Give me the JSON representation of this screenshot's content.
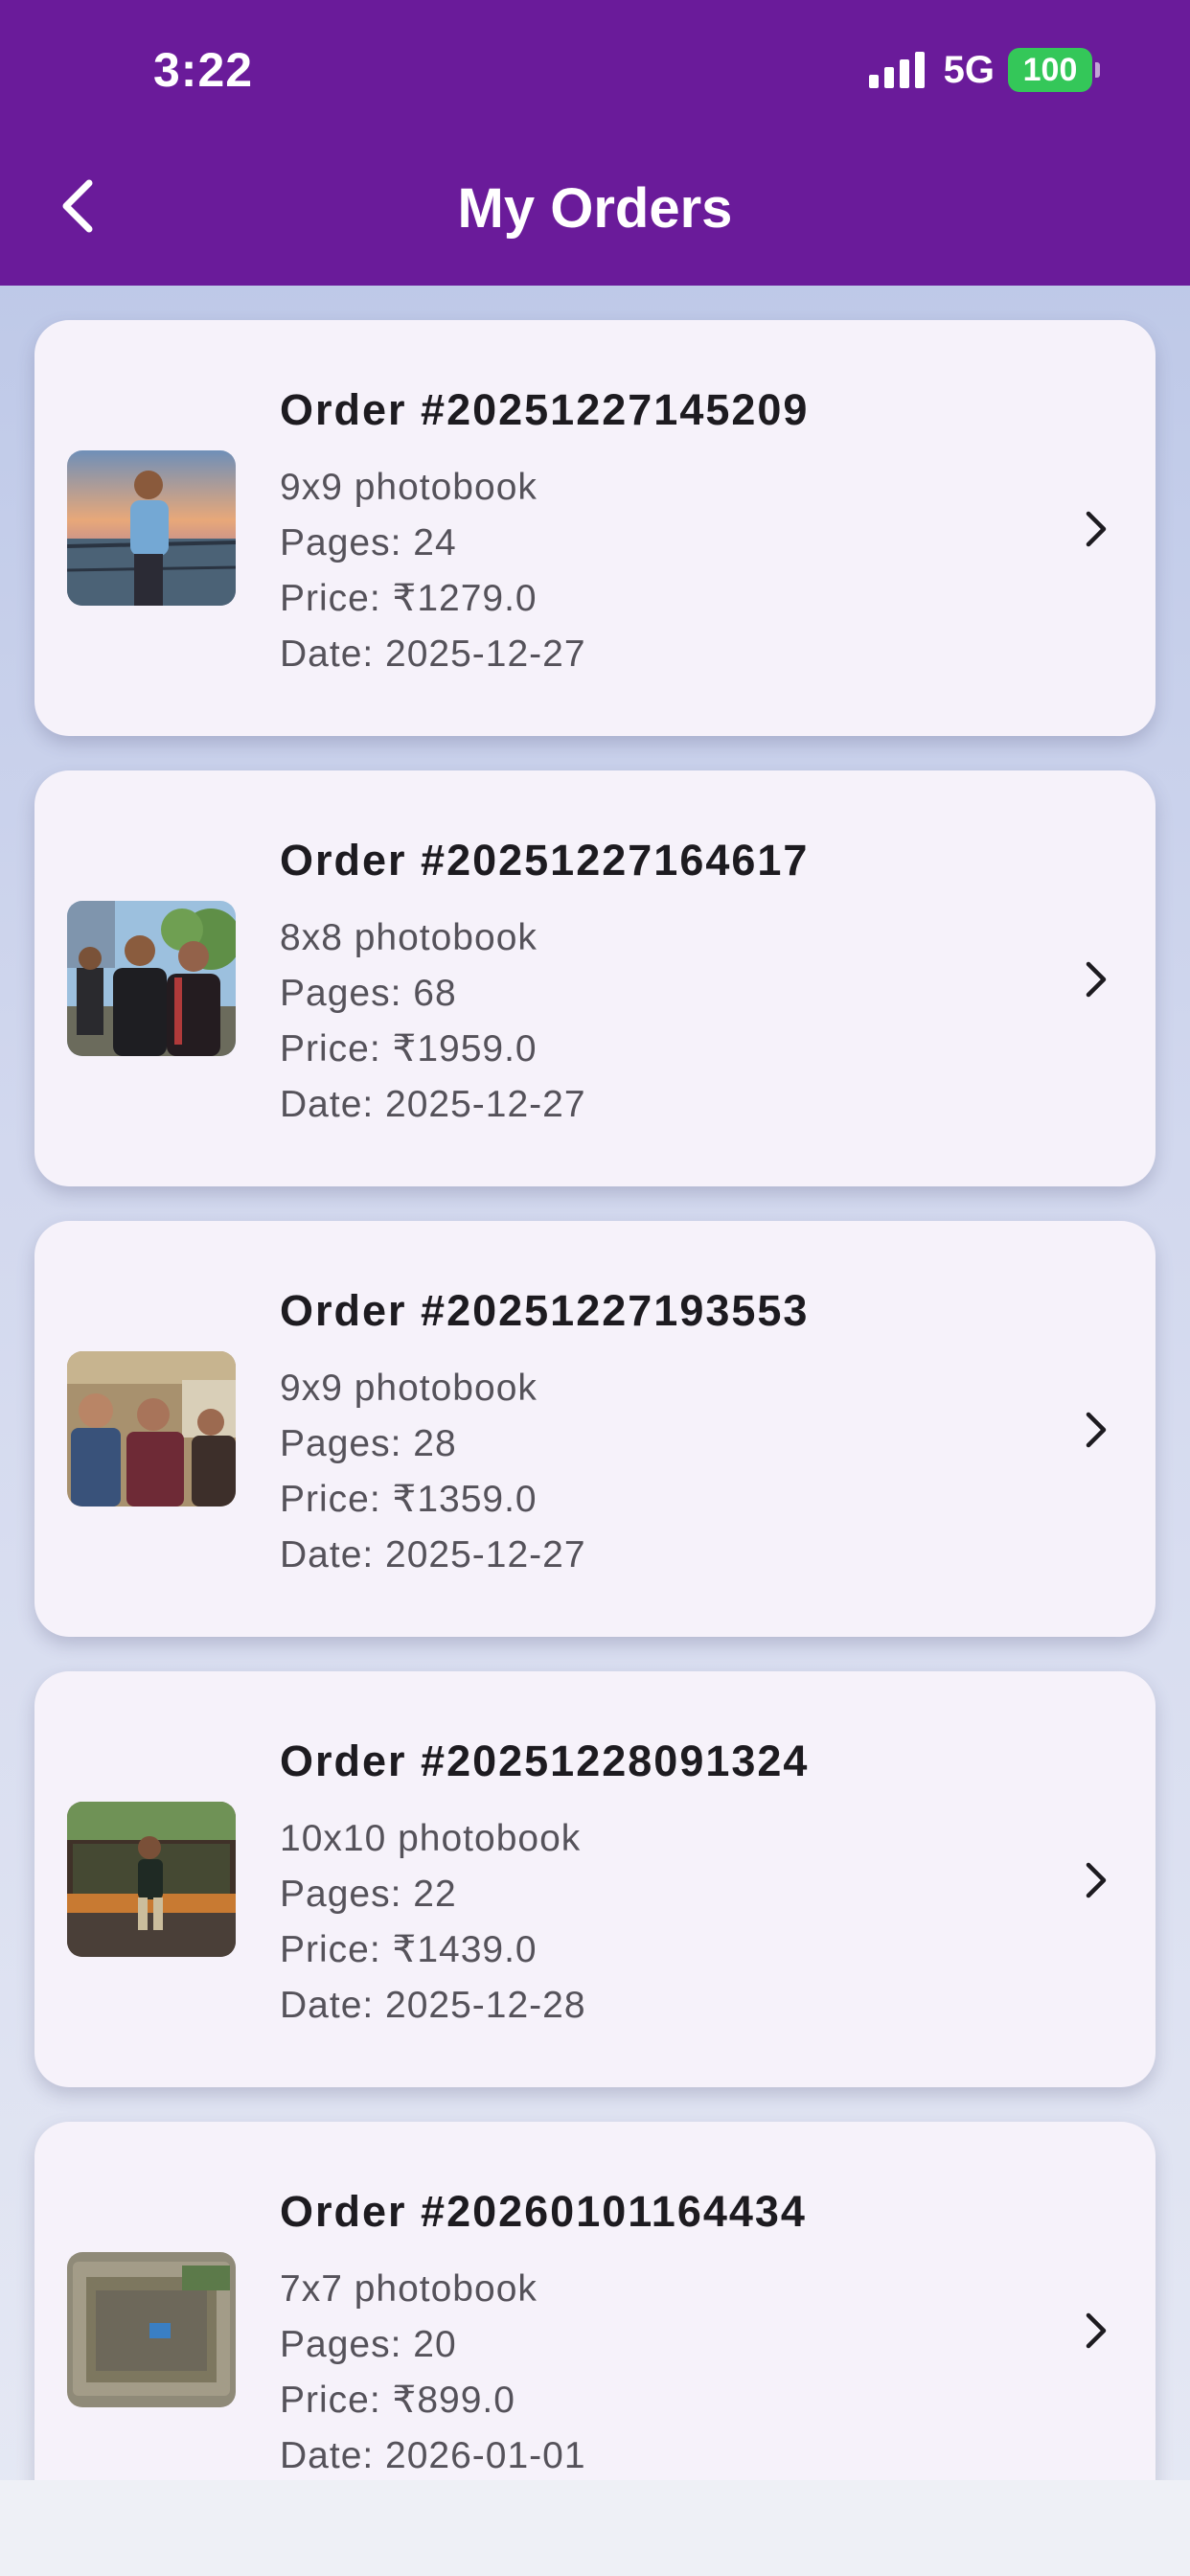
{
  "status_bar": {
    "time": "3:22",
    "network": "5G",
    "battery": "100"
  },
  "header": {
    "title": "My Orders",
    "back_icon": "chevron-left-icon"
  },
  "colors": {
    "appbar": "#6a1b9a",
    "card": "#f6f2fa",
    "battery": "#34c759"
  },
  "orders": [
    {
      "title": "Order #20251227145209",
      "product": "9x9 photobook",
      "pages": "Pages: 24",
      "price": "Price: ₹1279.0",
      "date": "Date: 2025-12-27"
    },
    {
      "title": "Order #20251227164617",
      "product": "8x8 photobook",
      "pages": "Pages: 68",
      "price": "Price: ₹1959.0",
      "date": "Date: 2025-12-27"
    },
    {
      "title": "Order #20251227193553",
      "product": "9x9 photobook",
      "pages": "Pages: 28",
      "price": "Price: ₹1359.0",
      "date": "Date: 2025-12-27"
    },
    {
      "title": "Order #20251228091324",
      "product": "10x10 photobook",
      "pages": "Pages: 22",
      "price": "Price: ₹1439.0",
      "date": "Date: 2025-12-28"
    },
    {
      "title": "Order #20260101164434",
      "product": "7x7 photobook",
      "pages": "Pages: 20",
      "price": "Price: ₹899.0",
      "date": "Date: 2026-01-01"
    }
  ]
}
